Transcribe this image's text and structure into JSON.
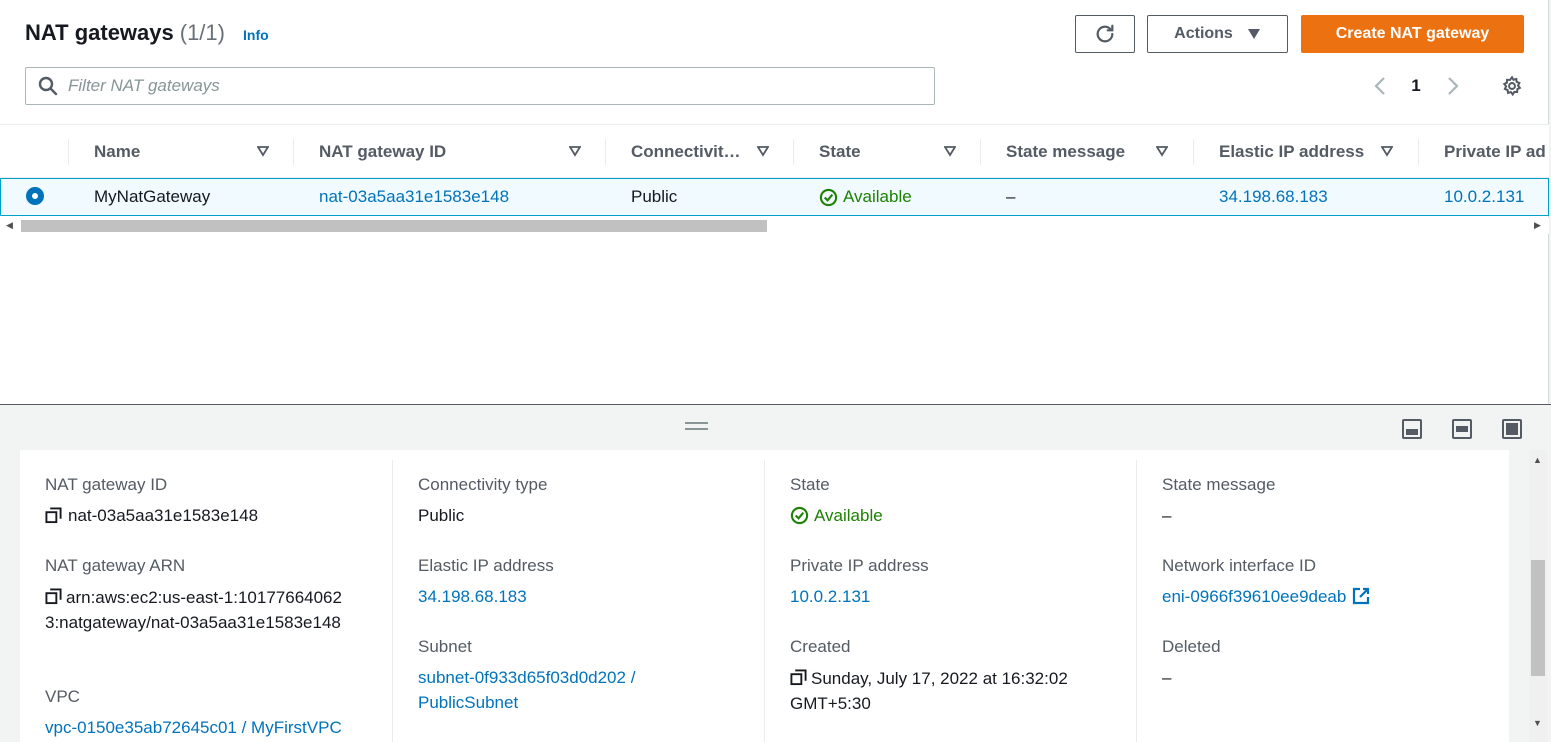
{
  "header": {
    "title": "NAT gateways",
    "count": "(1/1)",
    "info": "Info",
    "actions_label": "Actions",
    "create_label": "Create NAT gateway"
  },
  "filter": {
    "placeholder": "Filter NAT gateways"
  },
  "pagination": {
    "current_page": "1"
  },
  "table": {
    "columns": [
      "Name",
      "NAT gateway ID",
      "Connectivit…",
      "State",
      "State message",
      "Elastic IP address",
      "Private IP ad"
    ],
    "rows": [
      {
        "name": "MyNatGateway",
        "nat_gateway_id": "nat-03a5aa31e1583e148",
        "connectivity": "Public",
        "state": "Available",
        "state_message": "–",
        "elastic_ip": "34.198.68.183",
        "private_ip": "10.0.2.131",
        "selected": true
      }
    ]
  },
  "details": {
    "nat_gateway_id": {
      "label": "NAT gateway ID",
      "value": "nat-03a5aa31e1583e148"
    },
    "nat_gateway_arn": {
      "label": "NAT gateway ARN",
      "value": "arn:aws:ec2:us-east-1:101776640623:natgateway/nat-03a5aa31e1583e148"
    },
    "vpc": {
      "label": "VPC",
      "value": "vpc-0150e35ab72645c01 / MyFirstVPC"
    },
    "connectivity_type": {
      "label": "Connectivity type",
      "value": "Public"
    },
    "elastic_ip": {
      "label": "Elastic IP address",
      "value": "34.198.68.183"
    },
    "subnet": {
      "label": "Subnet",
      "value": "subnet-0f933d65f03d0d202 / PublicSubnet"
    },
    "state": {
      "label": "State",
      "value": "Available"
    },
    "private_ip": {
      "label": "Private IP address",
      "value": "10.0.2.131"
    },
    "created": {
      "label": "Created",
      "value": "Sunday, July 17, 2022 at 16:32:02 GMT+5:30"
    },
    "state_message": {
      "label": "State message",
      "value": "–"
    },
    "network_interface": {
      "label": "Network interface ID",
      "value": "eni-0966f39610ee9deab"
    },
    "deleted": {
      "label": "Deleted",
      "value": "–"
    }
  },
  "colors": {
    "primary_button": "#ec7211",
    "link": "#0073bb",
    "success": "#1d8102",
    "selected_row_bg": "#f1faff",
    "selected_row_border": "#00a1c9"
  },
  "icons": [
    "refresh-icon",
    "caret-down-icon",
    "search-icon",
    "chevron-left-icon",
    "chevron-right-icon",
    "gear-icon",
    "sort-icon",
    "status-ok-icon",
    "copy-icon",
    "external-link-icon"
  ]
}
